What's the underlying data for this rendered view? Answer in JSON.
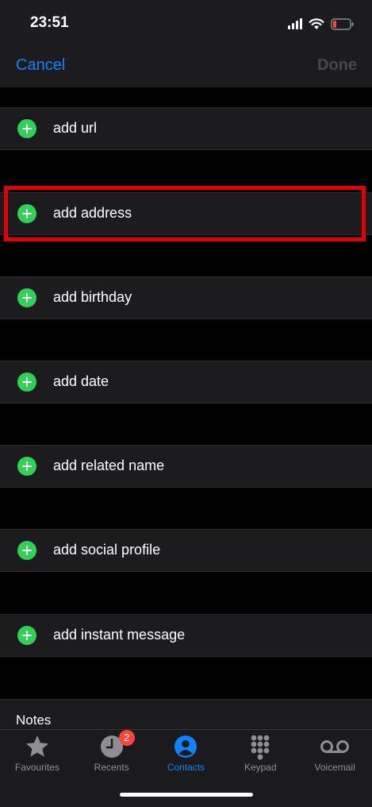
{
  "status_bar": {
    "time": "23:51",
    "icons": [
      "signal-icon",
      "wifi-icon",
      "battery-low-icon"
    ],
    "battery_color": "#ff453a"
  },
  "nav": {
    "cancel_label": "Cancel",
    "done_label": "Done"
  },
  "rows": {
    "url": "add url",
    "address": "add address",
    "birthday": "add birthday",
    "date": "add date",
    "related_name": "add related name",
    "social_profile": "add social profile",
    "instant_message": "add instant message"
  },
  "highlight": {
    "target": "add address",
    "color": "#e30000"
  },
  "notes": {
    "label": "Notes"
  },
  "tab_bar": {
    "active_tab": "Contacts",
    "tabs": [
      {
        "label": "Favourites",
        "icon": "star-icon"
      },
      {
        "label": "Recents",
        "icon": "clock-icon",
        "badge": "2"
      },
      {
        "label": "Contacts",
        "icon": "person-circle-icon"
      },
      {
        "label": "Keypad",
        "icon": "keypad-icon"
      },
      {
        "label": "Voicemail",
        "icon": "voicemail-icon"
      }
    ]
  },
  "colors": {
    "accent": "#0a84ff",
    "add_green": "#30d158",
    "badge_red": "#ff453a"
  }
}
